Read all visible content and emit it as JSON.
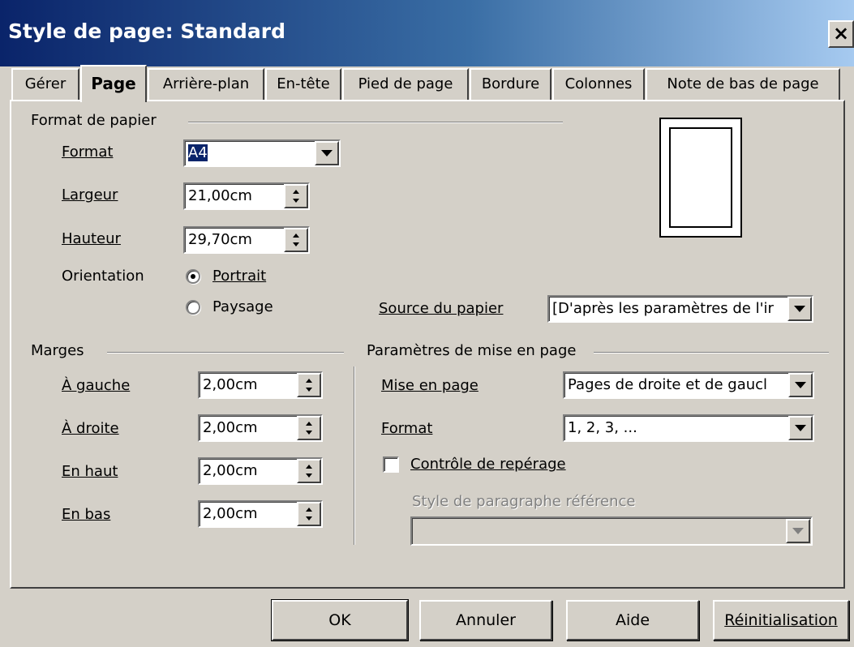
{
  "window": {
    "title": "Style de page: Standard",
    "close": "×"
  },
  "tabs": [
    "Gérer",
    "Page",
    "Arrière-plan",
    "En-tête",
    "Pied de page",
    "Bordure",
    "Colonnes",
    "Note de bas de page"
  ],
  "paper": {
    "group": "Format de papier",
    "format_label": "Format",
    "format_value": "A4",
    "width_label": "Largeur",
    "width_value": "21,00cm",
    "height_label": "Hauteur",
    "height_value": "29,70cm",
    "orientation_label": "Orientation",
    "portrait": "Portrait",
    "landscape": "Paysage",
    "orientation_selected": "Portrait",
    "source_label": "Source du papier",
    "source_value": "[D'après les paramètres de l'ir"
  },
  "margins": {
    "group": "Marges",
    "left_label": "À gauche",
    "left_value": "2,00cm",
    "right_label": "À droite",
    "right_value": "2,00cm",
    "top_label": "En haut",
    "top_value": "2,00cm",
    "bottom_label": "En bas",
    "bottom_value": "2,00cm"
  },
  "layout": {
    "group": "Paramètres de mise en page",
    "layout_label": "Mise en page",
    "layout_value": "Pages de droite et de gaucl",
    "format_label": "Format",
    "format_value": "1, 2, 3, ...",
    "register_label": "Contrôle de repérage",
    "register_checked": false,
    "ref_style_label": "Style de paragraphe référence",
    "ref_style_value": ""
  },
  "buttons": {
    "ok": "OK",
    "cancel": "Annuler",
    "help": "Aide",
    "reset": "Réinitialisation"
  }
}
